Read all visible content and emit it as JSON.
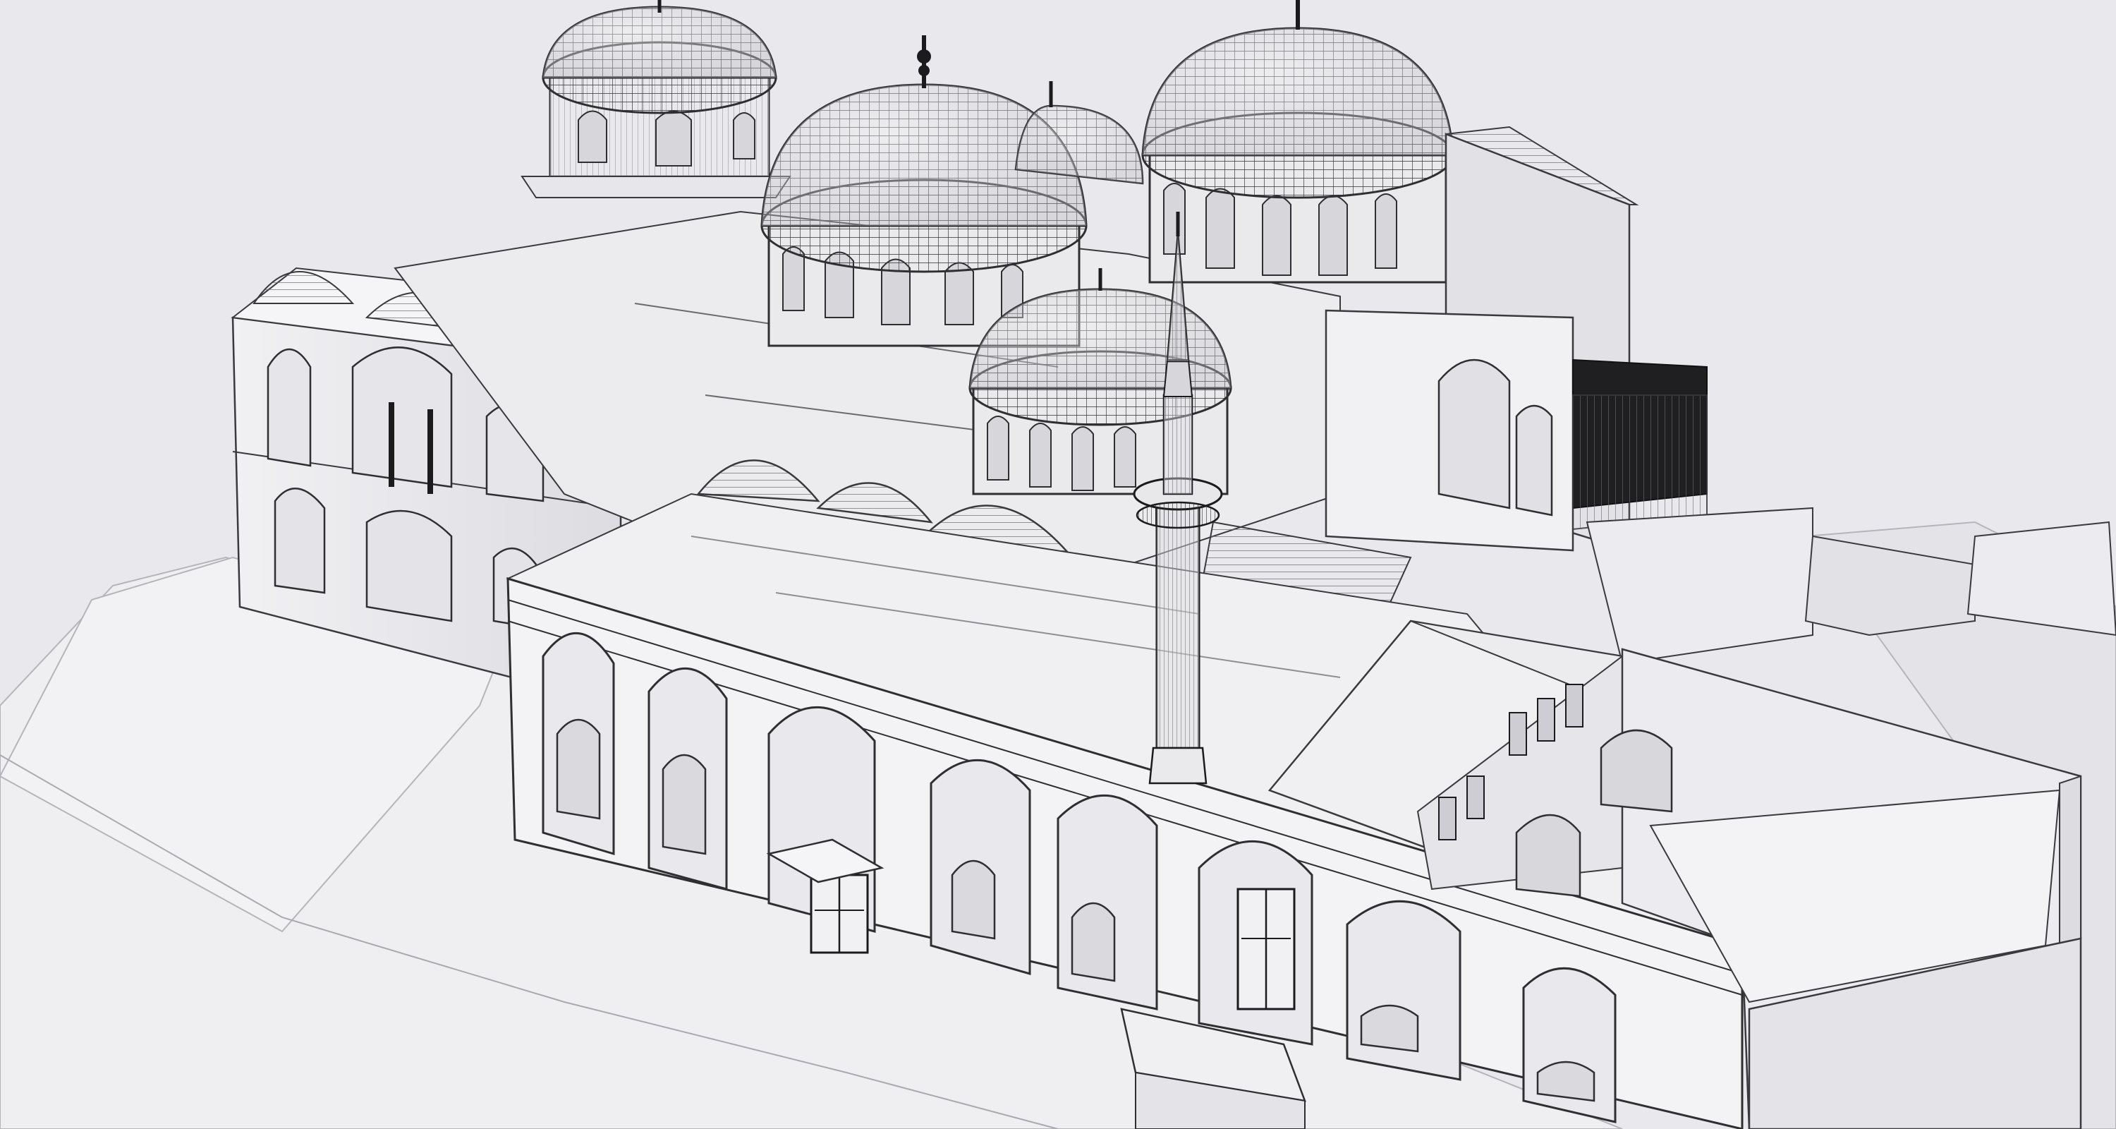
{
  "image": {
    "subject": "architectural-wireframe-render",
    "palette": {
      "background": "#e9e9ed",
      "ground": "#ededf1",
      "wall_light": "#f4f4f6",
      "wall_mid": "#e2e2e6",
      "wall_shadow": "#cfcfd5",
      "roof": "#ececef",
      "line": "#2b2b2e",
      "dark": "#1b1b1d"
    }
  }
}
